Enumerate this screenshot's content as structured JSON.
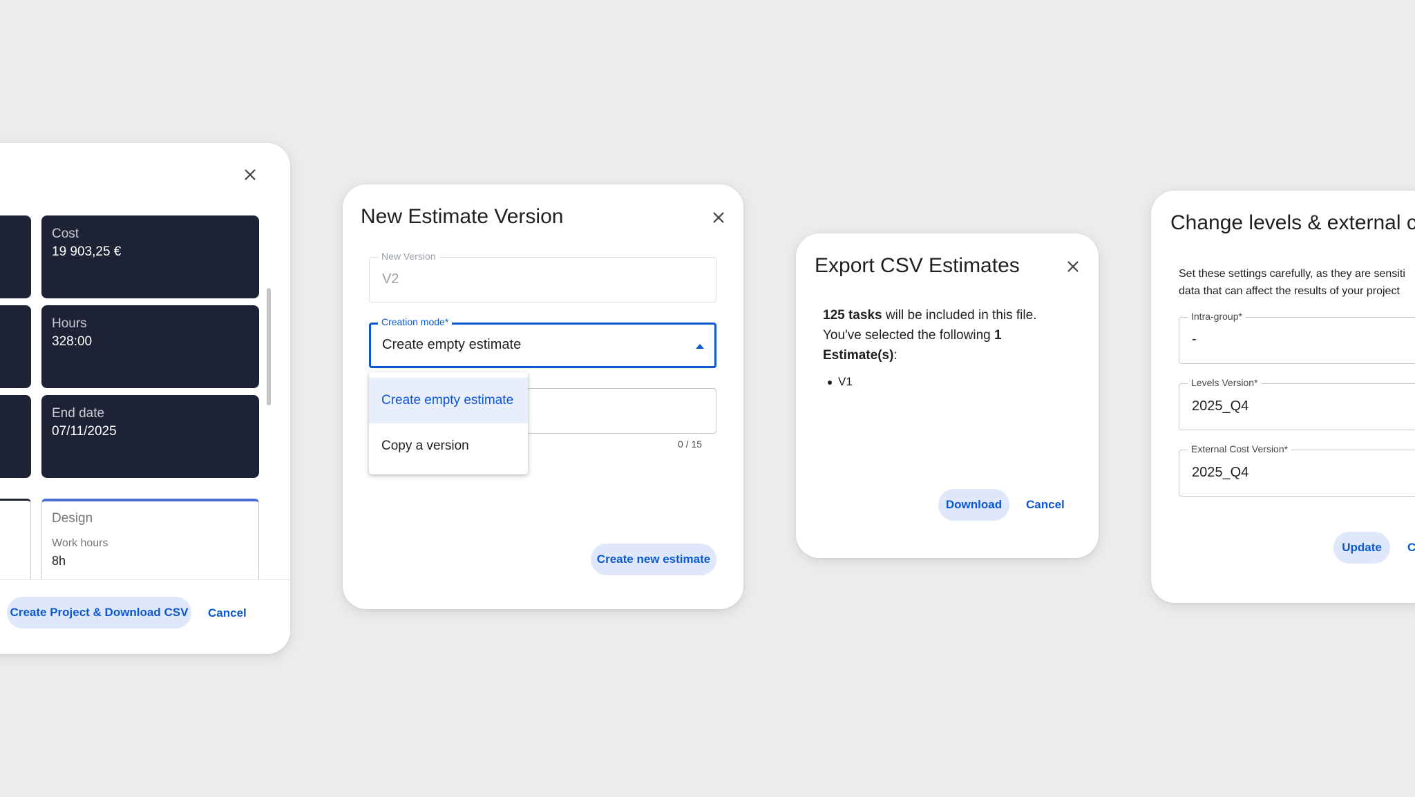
{
  "project_dialog": {
    "stats": [
      {
        "label": "Cost",
        "value": "19 903,25 €"
      },
      {
        "label": "Hours",
        "value": "328:00"
      },
      {
        "label": "End date",
        "value": "07/11/2025"
      }
    ],
    "design_card": {
      "title": "Design",
      "work_hours_label": "Work hours",
      "work_hours_value": "8h"
    },
    "primary_button": "Create Project & Download CSV",
    "cancel_button": "Cancel"
  },
  "new_estimate_dialog": {
    "title": "New Estimate Version",
    "new_version": {
      "label": "New Version",
      "value": "V2"
    },
    "creation_mode": {
      "label": "Creation mode*",
      "value": "Create empty estimate"
    },
    "menu_options": [
      "Create empty estimate",
      "Copy a version"
    ],
    "counter": "0 / 15",
    "primary_button": "Create new estimate"
  },
  "export_dialog": {
    "title": "Export CSV Estimates",
    "line1_bold": "125 tasks",
    "line1_rest": " will be included in this file.",
    "line2": "You've selected the following ",
    "line2_bold": "1",
    "line3_bold": "Estimate(s)",
    "line3_rest": ":",
    "items": [
      "V1"
    ],
    "download_button": "Download",
    "cancel_button": "Cancel"
  },
  "levels_dialog": {
    "title": "Change levels & external co",
    "description_line1": "Set these settings carefully, as they are sensiti",
    "description_line2": "data that can affect the results of your project",
    "fields": [
      {
        "label": "Intra-group*",
        "value": "-"
      },
      {
        "label": "Levels Version*",
        "value": "2025_Q4"
      },
      {
        "label": "External Cost Version*",
        "value": "2025_Q4"
      }
    ],
    "update_button": "Update",
    "cancel_button_partial": "C"
  },
  "colors": {
    "background": "#ececec",
    "dark_card": "#1e2235",
    "accent": "#0b57d0",
    "pill_bg": "#dfe8fb",
    "design_border": "#4a6cd4"
  }
}
